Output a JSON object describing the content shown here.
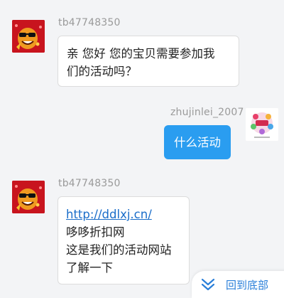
{
  "messages": [
    {
      "sender": "tb47748350",
      "lines": [
        "亲 您好 您的宝贝需要参加我",
        "们的活动吗？"
      ]
    },
    {
      "sender": "zhujinlei_2007",
      "lines": [
        "什么活动"
      ]
    },
    {
      "sender": "tb47748350",
      "link": "http://ddlxj.cn/",
      "lines": [
        "哆哆折扣网",
        "这是我们的活动网站",
        "了解一下"
      ]
    }
  ],
  "scroll_button": {
    "label": "回到底部",
    "icon": "double-chevron-down-icon"
  },
  "colors": {
    "page_bg": "#f3f4f6",
    "bubble_self": "#2a9df0",
    "bubble_other": "#ffffff",
    "link": "#1a6dc9",
    "accent": "#2a7fd9"
  },
  "icons": {
    "avatar_left": "emoji-sunglasses-avatar-icon",
    "avatar_right": "shop-logo-avatar-icon"
  }
}
